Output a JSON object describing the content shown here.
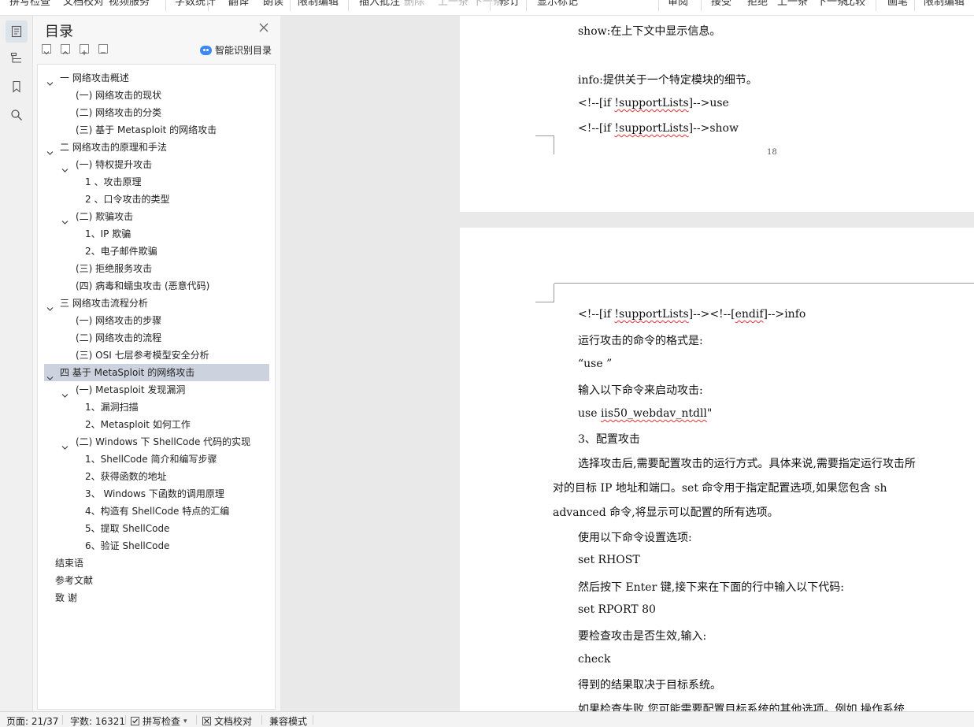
{
  "ribbon": {
    "items": [
      {
        "label": "拼写检查",
        "disabled": false
      },
      {
        "label": "文档校对",
        "disabled": false
      },
      {
        "label": "视频服务",
        "disabled": false
      },
      {
        "label": "字数统计",
        "disabled": false
      },
      {
        "label": "翻译",
        "disabled": false
      },
      {
        "label": "朗读",
        "disabled": false
      },
      {
        "label": "限制编辑",
        "disabled": false
      },
      {
        "label": "插入批注",
        "disabled": false
      },
      {
        "label": "删除",
        "disabled": true
      },
      {
        "label": "上一条",
        "disabled": true
      },
      {
        "label": "下一条",
        "disabled": true
      },
      {
        "label": "修订",
        "disabled": false
      },
      {
        "label": "显示标记",
        "disabled": false
      },
      {
        "label": "审阅",
        "disabled": false
      },
      {
        "label": "接受",
        "disabled": false
      },
      {
        "label": "拒绝",
        "disabled": false
      },
      {
        "label": "上一条",
        "disabled": false
      },
      {
        "label": "下一条",
        "disabled": false
      },
      {
        "label": "比较",
        "disabled": false
      },
      {
        "label": "画笔",
        "disabled": false
      },
      {
        "label": "限制编辑",
        "disabled": false
      }
    ]
  },
  "rail": {
    "items": [
      {
        "icon": "toc-icon",
        "active": true
      },
      {
        "icon": "navigation-pane-icon",
        "active": false
      },
      {
        "icon": "bookmark-icon",
        "active": false
      },
      {
        "icon": "search-icon",
        "active": false
      }
    ]
  },
  "toc": {
    "title": "目录",
    "smart_toc_label": "智能识别目录",
    "items": [
      {
        "label": "一 网络攻击概述",
        "level": 0,
        "expanded": true,
        "selected": false
      },
      {
        "label": "(一) 网络攻击的现状",
        "level": 1,
        "expanded": null,
        "selected": false
      },
      {
        "label": "(二) 网络攻击的分类",
        "level": 1,
        "expanded": null,
        "selected": false
      },
      {
        "label": "(三) 基于 Metasploit 的网络攻击",
        "level": 1,
        "expanded": null,
        "selected": false
      },
      {
        "label": "二 网络攻击的原理和手法",
        "level": 0,
        "expanded": true,
        "selected": false
      },
      {
        "label": "(一) 特权提升攻击",
        "level": 1,
        "expanded": true,
        "selected": false
      },
      {
        "label": "1 、攻击原理",
        "level": 2,
        "expanded": null,
        "selected": false
      },
      {
        "label": "2 、口令攻击的类型",
        "level": 2,
        "expanded": null,
        "selected": false
      },
      {
        "label": "(二) 欺骗攻击",
        "level": 1,
        "expanded": true,
        "selected": false
      },
      {
        "label": "1、IP 欺骗",
        "level": 2,
        "expanded": null,
        "selected": false
      },
      {
        "label": "2、电子邮件欺骗",
        "level": 2,
        "expanded": null,
        "selected": false
      },
      {
        "label": "(三) 拒绝服务攻击",
        "level": 1,
        "expanded": null,
        "selected": false
      },
      {
        "label": "(四) 病毒和蠕虫攻击 (恶意代码)",
        "level": 1,
        "expanded": null,
        "selected": false
      },
      {
        "label": "三 网络攻击流程分析",
        "level": 0,
        "expanded": true,
        "selected": false
      },
      {
        "label": "(一) 网络攻击的步骤",
        "level": 1,
        "expanded": null,
        "selected": false
      },
      {
        "label": "(二) 网络攻击的流程",
        "level": 1,
        "expanded": null,
        "selected": false
      },
      {
        "label": "(三) OSI 七层参考模型安全分析",
        "level": 1,
        "expanded": null,
        "selected": false
      },
      {
        "label": "四 基于 MetaSploit 的网络攻击",
        "level": 0,
        "expanded": true,
        "selected": true
      },
      {
        "label": "(一) Metasploit 发现漏洞",
        "level": 1,
        "expanded": true,
        "selected": false
      },
      {
        "label": "1、漏洞扫描",
        "level": 2,
        "expanded": null,
        "selected": false
      },
      {
        "label": "2、Metasploit 如何工作",
        "level": 2,
        "expanded": null,
        "selected": false
      },
      {
        "label": "(二) Windows 下 ShellCode 代码的实现",
        "level": 1,
        "expanded": true,
        "selected": false
      },
      {
        "label": "1、ShellCode 简介和编写步骤",
        "level": 2,
        "expanded": null,
        "selected": false
      },
      {
        "label": "2、获得函数的地址",
        "level": 2,
        "expanded": null,
        "selected": false
      },
      {
        "label": "3、 Windows 下函数的调用原理",
        "level": 2,
        "expanded": null,
        "selected": false
      },
      {
        "label": "4、构造有 ShellCode 特点的汇编",
        "level": 2,
        "expanded": null,
        "selected": false
      },
      {
        "label": "5、提取 ShellCode",
        "level": 2,
        "expanded": null,
        "selected": false
      },
      {
        "label": "6、验证 ShellCode",
        "level": 2,
        "expanded": null,
        "selected": false
      },
      {
        "label": "结束语",
        "level": 0,
        "expanded": null,
        "selected": false
      },
      {
        "label": "参考文献",
        "level": 0,
        "expanded": null,
        "selected": false
      },
      {
        "label": "致 谢",
        "level": 0,
        "expanded": null,
        "selected": false
      }
    ]
  },
  "document": {
    "page1": {
      "page_number": "18",
      "lines": [
        {
          "parts": [
            {
              "text": "show:在上下文中显示信息。"
            }
          ]
        },
        {
          "parts": [
            {
              "text": "info:提供关于一个特定模块的细节。"
            }
          ]
        },
        {
          "parts": [
            {
              "text": "<!--[if   "
            },
            {
              "text": "!supportLists",
              "spell": true
            },
            {
              "text": "]-->use"
            }
          ]
        },
        {
          "parts": [
            {
              "text": "<!--[if   "
            },
            {
              "text": "!supportLists",
              "spell": true
            },
            {
              "text": "]-->show"
            }
          ]
        }
      ]
    },
    "page2": {
      "lines": [
        {
          "parts": [
            {
              "text": "<!--[if   "
            },
            {
              "text": "!supportLists",
              "spell": true
            },
            {
              "text": "]--><!--["
            },
            {
              "text": "endif",
              "spell": true
            },
            {
              "text": "]-->info"
            }
          ]
        },
        {
          "parts": [
            {
              "text": "运行攻击的命令的格式是:"
            }
          ]
        },
        {
          "parts": [
            {
              "text": "“use   ”"
            }
          ]
        },
        {
          "parts": [
            {
              "text": "输入以下命令来启动攻击:"
            }
          ]
        },
        {
          "parts": [
            {
              "text": "use   "
            },
            {
              "text": "iis50_webdav_ntdll",
              "spell": true
            },
            {
              "text": "\""
            }
          ]
        },
        {
          "parts": [
            {
              "text": "3、配置攻击"
            }
          ]
        },
        {
          "parts": [
            {
              "text": "选择攻击后,需要配置攻击的运行方式。具体来说,需要指定运行攻击所"
            }
          ]
        },
        {
          "parts": [
            {
              "text": "对的目标 IP 地址和端口。set 命令用于指定配置选项,如果您包含 sh"
            }
          ]
        },
        {
          "parts": [
            {
              "text": "advanced 命令,将显示可以配置的所有选项。"
            }
          ]
        },
        {
          "parts": [
            {
              "text": "使用以下命令设置选项:"
            }
          ]
        },
        {
          "parts": [
            {
              "text": "set   RHOST"
            }
          ]
        },
        {
          "parts": [
            {
              "text": "然后按下 Enter 键,接下来在下面的行中输入以下代码:"
            }
          ]
        },
        {
          "parts": [
            {
              "text": "set   RPORT   80"
            }
          ]
        },
        {
          "parts": [
            {
              "text": "要检查攻击是否生效,输入:"
            }
          ]
        },
        {
          "parts": [
            {
              "text": "check"
            }
          ]
        },
        {
          "parts": [
            {
              "text": "得到的结果取决于目标系统。"
            }
          ]
        },
        {
          "parts": [
            {
              "text": "如果检查失败,您可能需要配置目标系统的其他选项。例如,操作系统"
            }
          ]
        }
      ]
    }
  },
  "status_bar": {
    "page": "页面: 21/37",
    "word_count": "字数: 16321",
    "spell_check": "拼写检查",
    "doc_proofread": "文档校对",
    "compat_mode": "兼容模式"
  },
  "colors": {
    "selection": "#ccd3de",
    "spell_underline": "#e23232",
    "accent_blue": "#3e88f5"
  }
}
